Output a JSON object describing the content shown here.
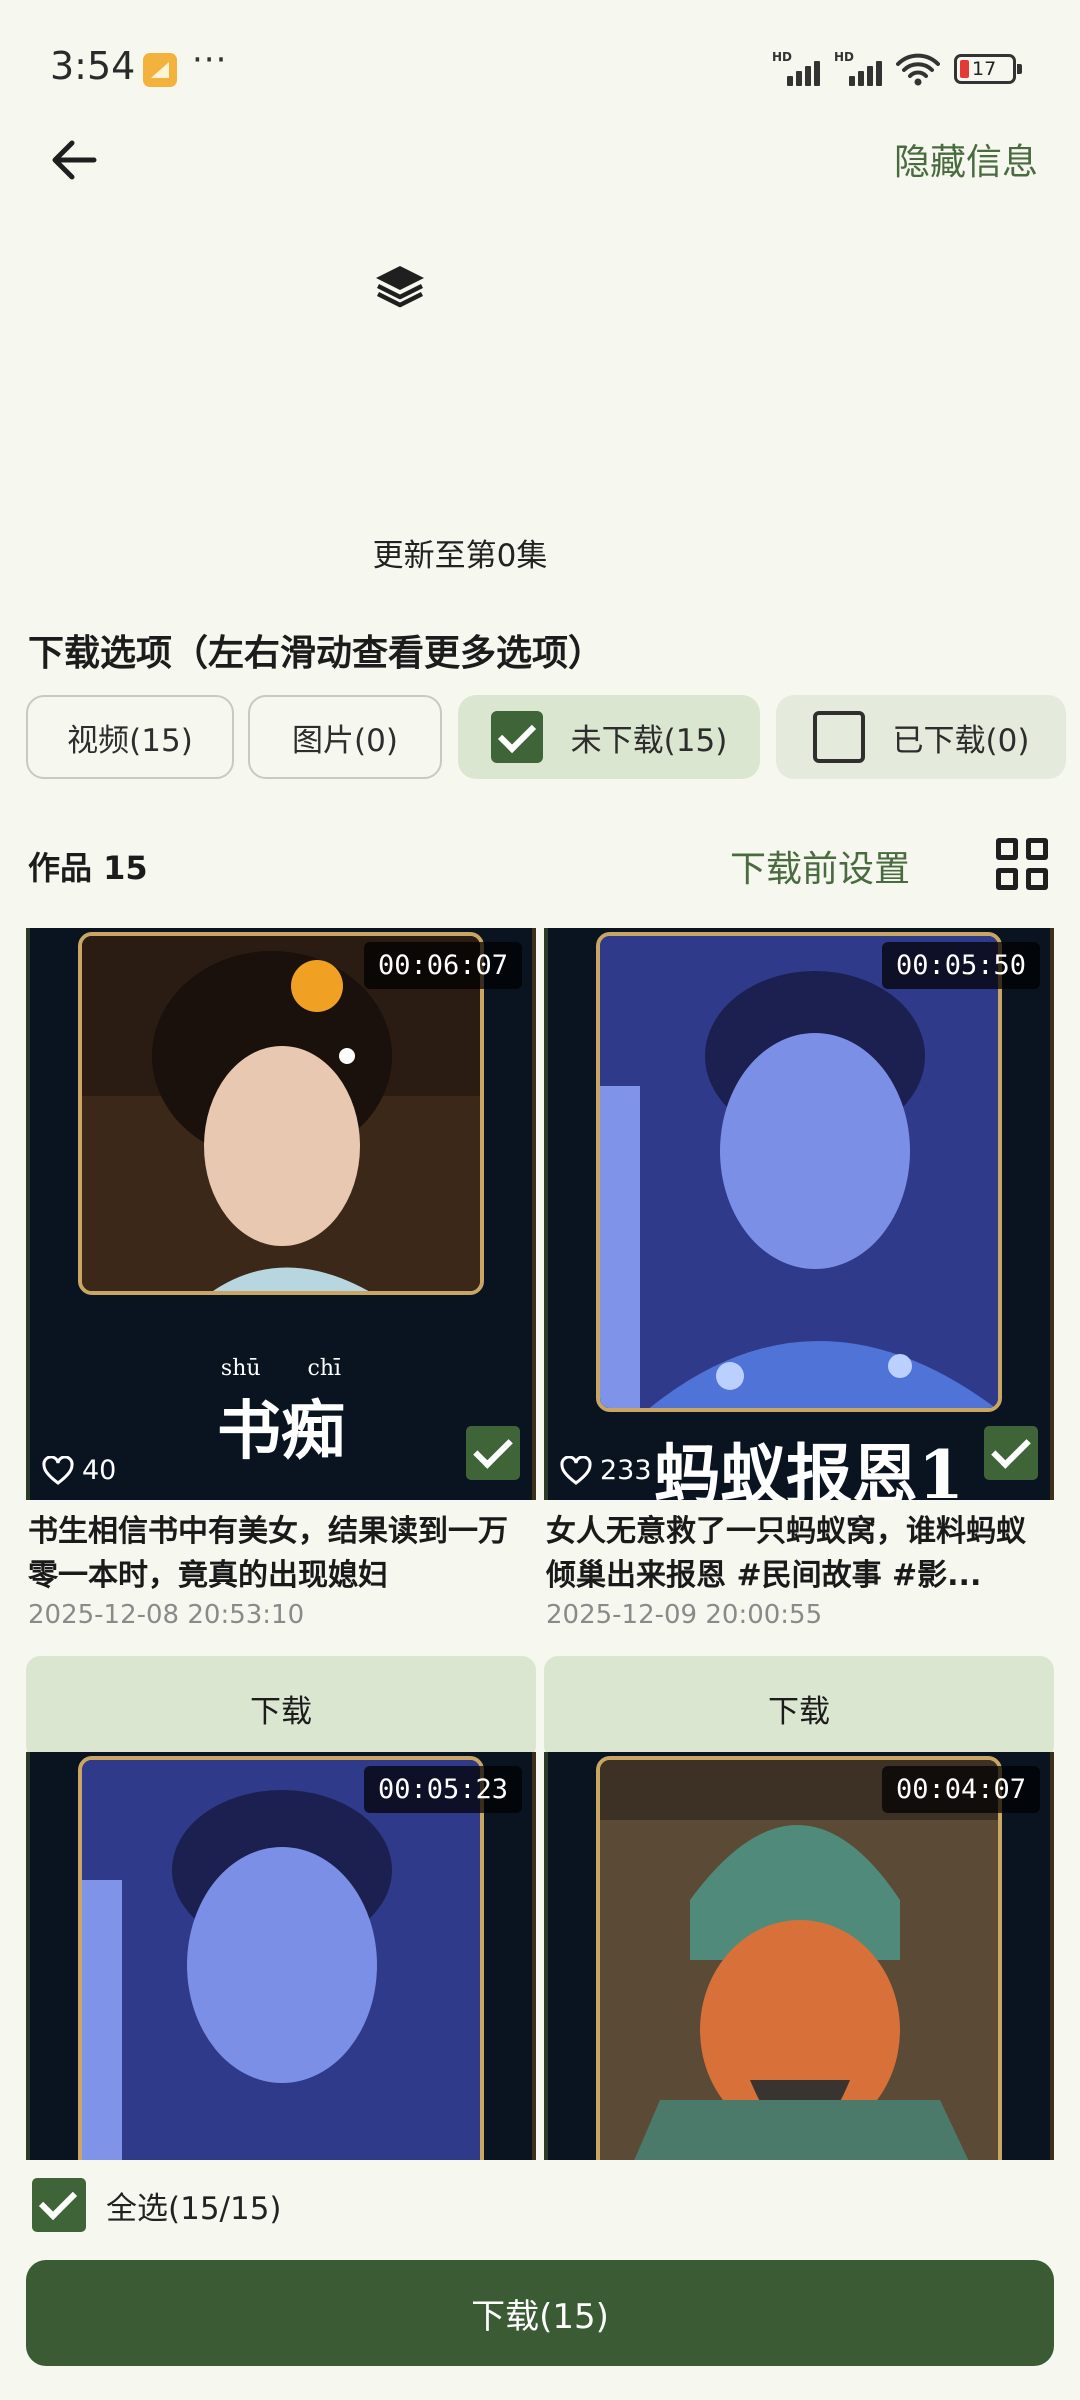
{
  "status_bar": {
    "time": "3:54",
    "more": "···",
    "signal_label_1": "HD",
    "signal_label_2": "HD",
    "battery": "17"
  },
  "header": {
    "back_icon": "arrow-left-icon",
    "hide_info": "隐藏信息",
    "layers_icon": "layers-icon",
    "update_text": "更新至第0集"
  },
  "download_options": {
    "title": "下载选项（左右滑动查看更多选项）",
    "chips": [
      {
        "label": "视频(15)",
        "checked": null
      },
      {
        "label": "图片(0)",
        "checked": null
      },
      {
        "label": "未下载(15)",
        "checked": true
      },
      {
        "label": "已下载(0)",
        "checked": false
      }
    ]
  },
  "works": {
    "title": "作品 15",
    "pre_download_settings": "下载前设置",
    "grid_icon": "grid-view-icon",
    "items": [
      {
        "duration": "00:06:07",
        "likes": "40",
        "checked": true,
        "pinyin_1": "shū",
        "pinyin_2": "chī",
        "overlay_text": "书痴",
        "title": "书生相信书中有美女，结果读到一万零一本时，竟真的出现媳妇",
        "date": "2025-12-08 20:53:10",
        "download_label": "下载"
      },
      {
        "duration": "00:05:50",
        "likes": "233",
        "checked": true,
        "overlay_text": "蚂蚁报恩1",
        "title": "女人无意救了一只蚂蚁窝，谁料蚂蚁倾巢出来报恩 #民间故事 #影...",
        "date": "2025-12-09 20:00:55",
        "download_label": "下载"
      },
      {
        "duration": "00:05:23"
      },
      {
        "duration": "00:04:07"
      }
    ]
  },
  "bottom": {
    "select_all": "全选(15/15)",
    "select_all_checked": true,
    "download_all": "下载(15)"
  },
  "colors": {
    "background": "#f6f8f0",
    "accent": "#3b5b34",
    "accent_light": "#dbe6d0",
    "link": "#4a6b3f"
  }
}
